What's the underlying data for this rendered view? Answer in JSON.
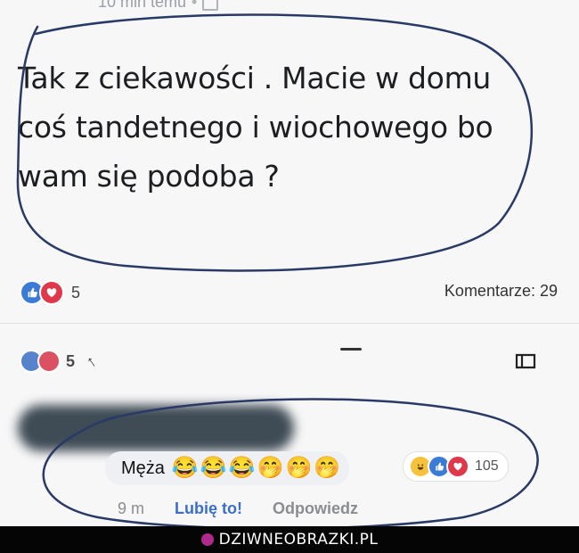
{
  "post": {
    "meta_time": "10 min temu",
    "meta_separator": "•",
    "text": "Tak z ciekawości . Macie w domu coś tandetnego i wiochowego bo wam się podoba ?",
    "reaction_count": "5",
    "comments_label": "Komentarze: 29"
  },
  "feed_row": {
    "reaction_count": "5"
  },
  "comment": {
    "text": "Męża",
    "emojis": [
      "😂",
      "😂",
      "😂",
      "🤭",
      "🤭",
      "🤭"
    ],
    "reaction_count": "105",
    "time": "9 m",
    "like_label": "Lubię to!",
    "reply_label": "Odpowiedz"
  },
  "watermark": {
    "text": "DZIWNEOBRAZKI.PL"
  },
  "colors": {
    "like": "#3a7bd5",
    "love": "#e0384a",
    "haha": "#f5c33b",
    "link": "#3b6fc9",
    "annotation_ink": "#2a3a66"
  }
}
